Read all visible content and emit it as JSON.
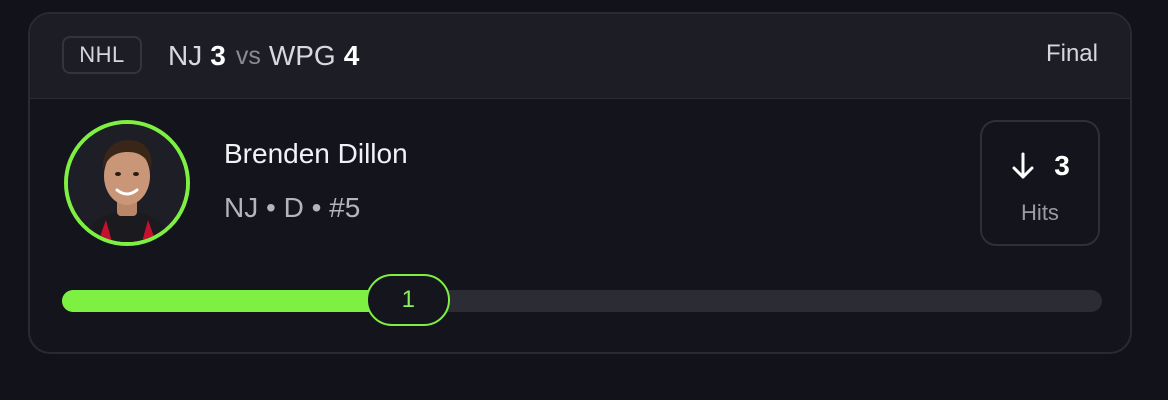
{
  "game": {
    "league": "NHL",
    "away_team": "NJ",
    "away_score": "3",
    "vs_text": "vs",
    "home_team": "WPG",
    "home_score": "4",
    "status": "Final"
  },
  "player": {
    "name": "Brenden Dillon",
    "meta": "NJ • D • #5",
    "ring_color": "#7ef042"
  },
  "stat": {
    "direction_icon": "arrow-down-icon",
    "line": "3",
    "label": "Hits"
  },
  "progress": {
    "current": "1",
    "fraction": 0.333,
    "accent": "#7ef042"
  }
}
